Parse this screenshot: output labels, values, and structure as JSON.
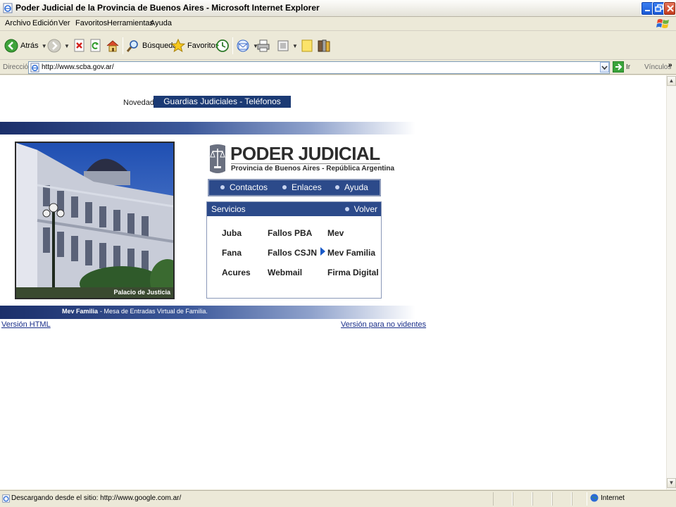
{
  "window": {
    "title": "Poder Judicial de la Provincia de Buenos Aires - Microsoft Internet Explorer"
  },
  "menu": {
    "items": [
      "Archivo",
      "Edición",
      "Ver",
      "Favoritos",
      "Herramientas",
      "Ayuda"
    ]
  },
  "toolbar": {
    "back_label": "Atrás",
    "search_label": "Búsqueda",
    "favorites_label": "Favoritos"
  },
  "address": {
    "label": "Dirección",
    "url": "http://www.scba.gov.ar/",
    "go_label": "Ir",
    "links_label": "Vínculos",
    "more": "»"
  },
  "page": {
    "novedad_label": "Novedad:",
    "novedad_link": "Guardias Judiciales - Teléfonos",
    "photo_caption": "Palacio de Justicia",
    "logo_title": "PODER JUDICIAL",
    "logo_subtitle": "Provincia de Buenos Aires - República Argentina",
    "nav": [
      "Contactos",
      "Enlaces",
      "Ayuda"
    ],
    "services": {
      "title": "Servicios",
      "back": "Volver",
      "items": [
        [
          "Juba",
          "Fallos PBA",
          "Mev"
        ],
        [
          "Fana",
          "Fallos CSJN",
          "Mev Familia"
        ],
        [
          "Acures",
          "Webmail",
          "Firma Digital"
        ]
      ]
    },
    "mev_title": "Mev Familia",
    "mev_desc": "- Mesa de Entradas Virtual de Familia.",
    "link_html": "Versión HTML",
    "link_accessible": "Versión para no videntes"
  },
  "status": {
    "text": "Descargando desde el sitio: http://www.google.com.ar/",
    "zone": "Internet"
  },
  "colors": {
    "accent": "#2c4a8a",
    "link": "#1a2f8a"
  }
}
